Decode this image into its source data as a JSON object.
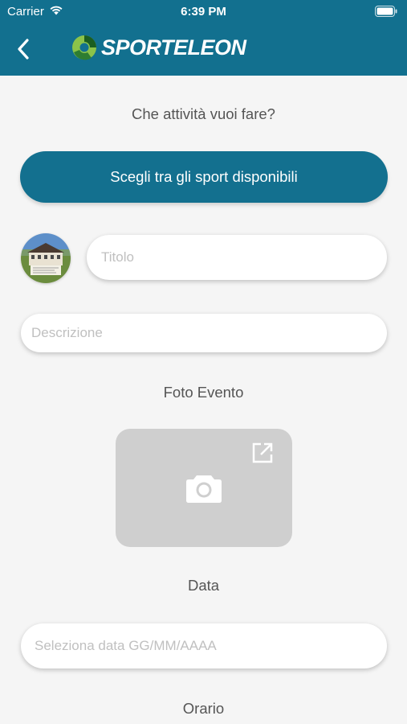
{
  "status": {
    "carrier": "Carrier",
    "time": "6:39 PM"
  },
  "header": {
    "brand": "SPORTELEON",
    "colors": {
      "bar": "#12708f",
      "brand_green": "#8bc34a"
    }
  },
  "form": {
    "question": "Che attività vuoi fare?",
    "sport_button": "Scegli tra gli sport disponibili",
    "title_placeholder": "Titolo",
    "description_placeholder": "Descrizione",
    "photo_label": "Foto Evento",
    "date_label": "Data",
    "date_placeholder": "Seleziona data GG/MM/AAAA",
    "time_label": "Orario"
  },
  "icons": [
    "wifi-icon",
    "battery-icon",
    "back-chevron-icon",
    "camera-icon",
    "open-external-icon"
  ]
}
